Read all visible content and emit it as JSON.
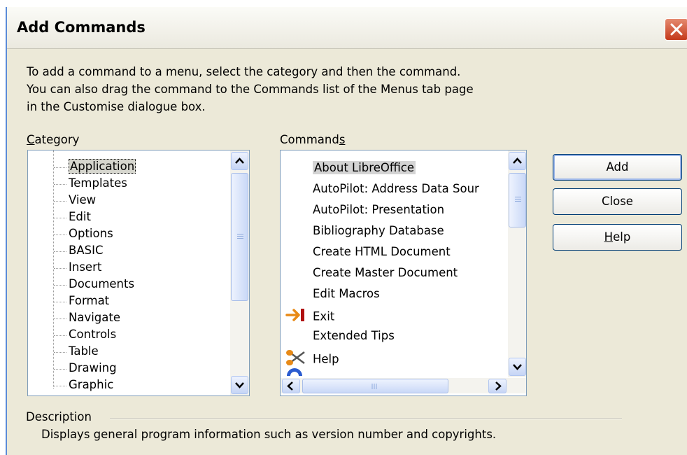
{
  "dialog": {
    "title": "Add Commands",
    "instructions": "To add a command to a menu, select the category and then the command.\nYou can also drag the command to the Commands list of the Menus tab page\nin the Customise dialogue box."
  },
  "category": {
    "label_prefix": "",
    "label_mnemonic": "C",
    "label_rest": "ategory",
    "items": [
      "Application",
      "Templates",
      "View",
      "Edit",
      "Options",
      "BASIC",
      "Insert",
      "Documents",
      "Format",
      "Navigate",
      "Controls",
      "Table",
      "Drawing",
      "Graphic"
    ],
    "selected": "Application"
  },
  "commands": {
    "label_prefix": "Command",
    "label_mnemonic": "s",
    "label_rest": "",
    "items": [
      "About LibreOffice",
      "AutoPilot: Address Data Sour",
      "AutoPilot: Presentation",
      "Bibliography Database",
      "Create HTML Document",
      "Create Master Document",
      "Edit Macros",
      "Exit",
      "Extended Tips",
      "Help"
    ],
    "selected": "About LibreOffice",
    "icons": {
      "Exit": "exit-arrow-icon",
      "Help": "scissors-icon",
      "partial": "help-agent-icon"
    }
  },
  "buttons": {
    "add": "Add",
    "close": "Close",
    "help_mnemonic": "H",
    "help_rest": "elp"
  },
  "description": {
    "label": "Description",
    "text": "Displays general program information such as version number and copyrights."
  },
  "colors": {
    "dialog_bg": "#ece9d8",
    "titlebar_close": "#c4381a",
    "button_border": "#003c74",
    "listbox_border": "#7f9db9"
  }
}
